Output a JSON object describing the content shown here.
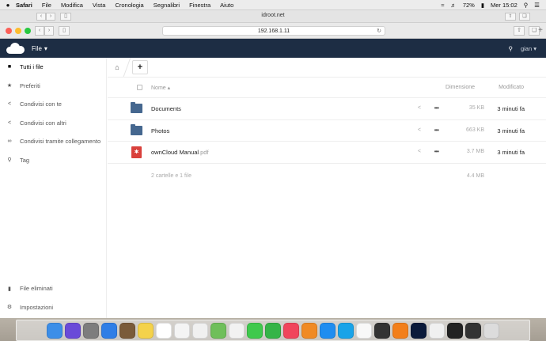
{
  "menubar": {
    "items": [
      "Safari",
      "File",
      "Modifica",
      "Vista",
      "Cronologia",
      "Segnalibri",
      "Finestra",
      "Aiuto"
    ],
    "battery": "72%",
    "clock": "Mer 15:02"
  },
  "browser": {
    "tab_title": "idroot.net",
    "url": "192.168.1.11"
  },
  "header": {
    "app_name": "File",
    "user": "gian"
  },
  "sidebar": {
    "items": [
      {
        "label": "Tutti i file",
        "icon": "folder-icon",
        "active": true
      },
      {
        "label": "Preferiti",
        "icon": "star-icon",
        "active": false
      },
      {
        "label": "Condivisi con te",
        "icon": "share-icon",
        "active": false
      },
      {
        "label": "Condivisi con altri",
        "icon": "share-icon",
        "active": false
      },
      {
        "label": "Condivisi tramite collegamento",
        "icon": "link-icon",
        "active": false
      },
      {
        "label": "Tag",
        "icon": "search-icon",
        "active": false
      }
    ],
    "bottom": [
      {
        "label": "File eliminati",
        "icon": "trash-icon"
      },
      {
        "label": "Impostazioni",
        "icon": "gear-icon"
      }
    ]
  },
  "table": {
    "col_name": "Nome",
    "col_size": "Dimensione",
    "col_modified": "Modificato",
    "rows": [
      {
        "name": "Documents",
        "ext": "",
        "type": "folder",
        "size": "35 KB",
        "modified": "3 minuti fa"
      },
      {
        "name": "Photos",
        "ext": "",
        "type": "folder",
        "size": "663 KB",
        "modified": "3 minuti fa"
      },
      {
        "name": "ownCloud Manual",
        "ext": ".pdf",
        "type": "pdf",
        "size": "3.7 MB",
        "modified": "3 minuti fa"
      }
    ],
    "summary": "2 cartelle e 1 file",
    "summary_size": "4.4 MB"
  },
  "colors": {
    "header_bg": "#1d2d44",
    "folder": "#45678f",
    "pdf": "#d9403b"
  },
  "dock_icons": [
    "finder-icon",
    "siri-icon",
    "launchpad-icon",
    "safari-icon",
    "mail-icon",
    "notes-icon",
    "calendar-icon",
    "stickies-icon",
    "reminders-icon",
    "maps-icon",
    "photos-icon",
    "messages-icon",
    "facetime-icon",
    "music-icon",
    "books-icon",
    "app-store-icon",
    "skype-icon",
    "textedit-icon",
    "podcast-icon",
    "vlc-icon",
    "photoshop-icon",
    "chrome-icon",
    "terminal-icon",
    "console-icon",
    "trash-icon"
  ]
}
